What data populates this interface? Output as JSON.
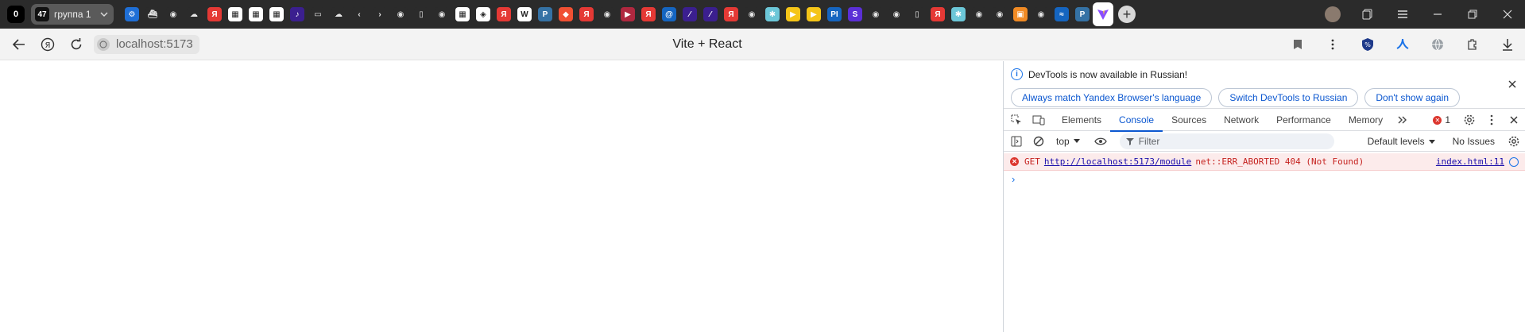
{
  "tabstrip": {
    "tab_counter": "0",
    "group": {
      "count": "47",
      "name": "группа 1"
    },
    "pinned": [
      {
        "name": "settings-tab",
        "bg": "#1f6fd6",
        "glyph": "⚙"
      },
      {
        "name": "ship-tab",
        "bg": "#2b2b2b",
        "glyph": "⛴"
      },
      {
        "name": "github-tab",
        "bg": "#2b2b2b",
        "glyph": "◉"
      },
      {
        "name": "cloud-tab",
        "bg": "#2b2b2b",
        "glyph": "☁"
      },
      {
        "name": "yandex-tab",
        "bg": "#e53935",
        "glyph": "Я"
      },
      {
        "name": "grid-app-tab",
        "bg": "#ffffff",
        "glyph": "▦"
      },
      {
        "name": "grid-app-tab",
        "bg": "#ffffff",
        "glyph": "▦"
      },
      {
        "name": "grid-app-tab",
        "bg": "#ffffff",
        "glyph": "▦"
      },
      {
        "name": "music-tab",
        "bg": "#3b1f8f",
        "glyph": "♪"
      },
      {
        "name": "folder-tab",
        "bg": "#2b2b2b",
        "glyph": "▭"
      },
      {
        "name": "cloud-tab",
        "bg": "#2b2b2b",
        "glyph": "☁"
      },
      {
        "name": "back-tab",
        "bg": "#2b2b2b",
        "glyph": "‹"
      },
      {
        "name": "forward-tab",
        "bg": "#2b2b2b",
        "glyph": "›"
      },
      {
        "name": "github-tab",
        "bg": "#2b2b2b",
        "glyph": "◉"
      },
      {
        "name": "document-tab",
        "bg": "#2b2b2b",
        "glyph": "▯"
      },
      {
        "name": "github-tab",
        "bg": "#2b2b2b",
        "glyph": "◉"
      },
      {
        "name": "grid-app-tab",
        "bg": "#ffffff",
        "glyph": "▦"
      },
      {
        "name": "codepen-tab",
        "bg": "#ffffff",
        "glyph": "◈"
      },
      {
        "name": "yandex-tab",
        "bg": "#e53935",
        "glyph": "Я"
      },
      {
        "name": "wikipedia-tab",
        "bg": "#ffffff",
        "glyph": "W"
      },
      {
        "name": "python-tab",
        "bg": "#3572a5",
        "glyph": "P"
      },
      {
        "name": "git-tab",
        "bg": "#f05033",
        "glyph": "◆"
      },
      {
        "name": "yandex-tab",
        "bg": "#e53935",
        "glyph": "Я"
      },
      {
        "name": "github-tab",
        "bg": "#2b2b2b",
        "glyph": "◉"
      },
      {
        "name": "video-tab",
        "bg": "#b0283f",
        "glyph": "▶"
      },
      {
        "name": "yandex-tab",
        "bg": "#e53935",
        "glyph": "Я"
      },
      {
        "name": "mail-tab",
        "bg": "#1565c0",
        "glyph": "@"
      },
      {
        "name": "stripe-tab",
        "bg": "#3b1f8f",
        "glyph": "⁄"
      },
      {
        "name": "stripe-tab",
        "bg": "#3b1f8f",
        "glyph": "⁄"
      },
      {
        "name": "yandex-tab",
        "bg": "#e53935",
        "glyph": "Я"
      },
      {
        "name": "github-tab",
        "bg": "#2b2b2b",
        "glyph": "◉"
      },
      {
        "name": "puzzle-tab",
        "bg": "#6cc7d8",
        "glyph": "✱"
      },
      {
        "name": "play-tab",
        "bg": "#f5c518",
        "glyph": "▶"
      },
      {
        "name": "play-tab",
        "bg": "#f5c518",
        "glyph": "▶"
      },
      {
        "name": "pi-tab",
        "bg": "#1565c0",
        "glyph": "PI"
      },
      {
        "name": "s-tab",
        "bg": "#5b2fd6",
        "glyph": "S"
      },
      {
        "name": "github-tab",
        "bg": "#2b2b2b",
        "glyph": "◉"
      },
      {
        "name": "github-tab",
        "bg": "#2b2b2b",
        "glyph": "◉"
      },
      {
        "name": "document-tab",
        "bg": "#2b2b2b",
        "glyph": "▯"
      },
      {
        "name": "yandex-tab",
        "bg": "#e53935",
        "glyph": "Я"
      },
      {
        "name": "puzzle-tab",
        "bg": "#6cc7d8",
        "glyph": "✱"
      },
      {
        "name": "github-tab",
        "bg": "#2b2b2b",
        "glyph": "◉"
      },
      {
        "name": "github-tab",
        "bg": "#2b2b2b",
        "glyph": "◉"
      },
      {
        "name": "squares-tab",
        "bg": "#f08a24",
        "glyph": "▣"
      },
      {
        "name": "github-tab",
        "bg": "#2b2b2b",
        "glyph": "◉"
      },
      {
        "name": "wave-tab",
        "bg": "#1565c0",
        "glyph": "≈"
      },
      {
        "name": "python-tab",
        "bg": "#3572a5",
        "glyph": "P"
      }
    ],
    "active_tab": {
      "name": "vite-tab",
      "glyph": "V"
    }
  },
  "addressbar": {
    "url": "localhost:5173",
    "page_title": "Vite + React"
  },
  "devtools": {
    "infobar": {
      "message": "DevTools is now available in Russian!",
      "buttons": [
        "Always match Yandex Browser's language",
        "Switch DevTools to Russian",
        "Don't show again"
      ]
    },
    "tabs": [
      "Elements",
      "Console",
      "Sources",
      "Network",
      "Performance",
      "Memory"
    ],
    "active_tab": "Console",
    "error_count": "1",
    "toolbar": {
      "context": "top",
      "filter_placeholder": "Filter",
      "levels": "Default levels",
      "issues": "No Issues"
    },
    "console": {
      "error": {
        "method": "GET",
        "url": "http://localhost:5173/module",
        "message": "net::ERR_ABORTED 404 (Not Found)",
        "source": "index.html:11"
      },
      "prompt": "›"
    }
  },
  "colors": {
    "accent": "#0b57d0",
    "error": "#dc362e",
    "error_bg": "#fcebeb"
  }
}
